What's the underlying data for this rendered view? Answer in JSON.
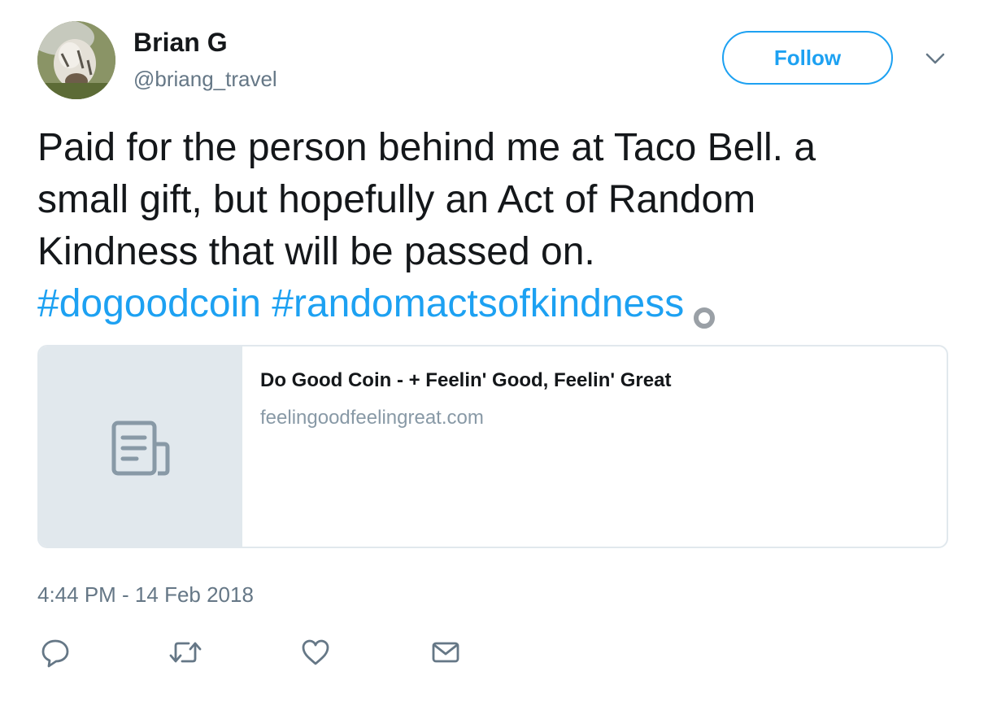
{
  "user": {
    "name": "Brian G",
    "handle": "@briang_travel",
    "avatar_icon": "avatar-photo"
  },
  "follow_button": {
    "label": "Follow"
  },
  "menu": {
    "caret_icon": "chevron-down-icon"
  },
  "tweet": {
    "lines": [
      "Paid for the person behind me at Taco Bell. a",
      "small gift, but hopefully an Act of Random",
      "Kindness that will be passed on."
    ],
    "hashtags": [
      "#dogoodcoin",
      "#randomactsofkindness"
    ]
  },
  "card": {
    "title": "Do Good Coin - + Feelin' Good, Feelin' Great",
    "domain": "feelingoodfeelingreat.com",
    "thumb_icon": "document-icon"
  },
  "timestamp": "4:44 PM - 14 Feb 2018",
  "actions": [
    "reply-icon",
    "retweet-icon",
    "like-icon",
    "message-icon"
  ],
  "colors": {
    "accent": "#1da1f2",
    "text": "#14171a",
    "secondary": "#657786",
    "border": "#e1e8ed"
  }
}
